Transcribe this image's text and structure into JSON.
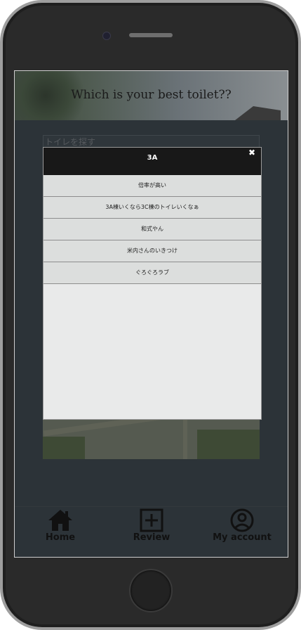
{
  "hero": {
    "title": "Which is your best toilet??"
  },
  "search": {
    "placeholder": "トイレを探す"
  },
  "modal": {
    "title": "3A",
    "close_icon": "close-icon",
    "items": [
      {
        "label": "倍率が高い"
      },
      {
        "label": "3A棟いくなら3C棟のトイレいくなぁ"
      },
      {
        "label": "和式やん"
      },
      {
        "label": "米内さんのいきつけ"
      },
      {
        "label": "ぐろぐろラブ"
      }
    ]
  },
  "nav": {
    "home": {
      "label": "Home",
      "icon": "home-icon"
    },
    "review": {
      "label": "Review",
      "icon": "plus-square-icon"
    },
    "account": {
      "label": "My account",
      "icon": "user-circle-icon"
    }
  },
  "colors": {
    "screen_bg": "#2c3338",
    "modal_header": "#181818",
    "list_bg": "#dcdedd"
  }
}
